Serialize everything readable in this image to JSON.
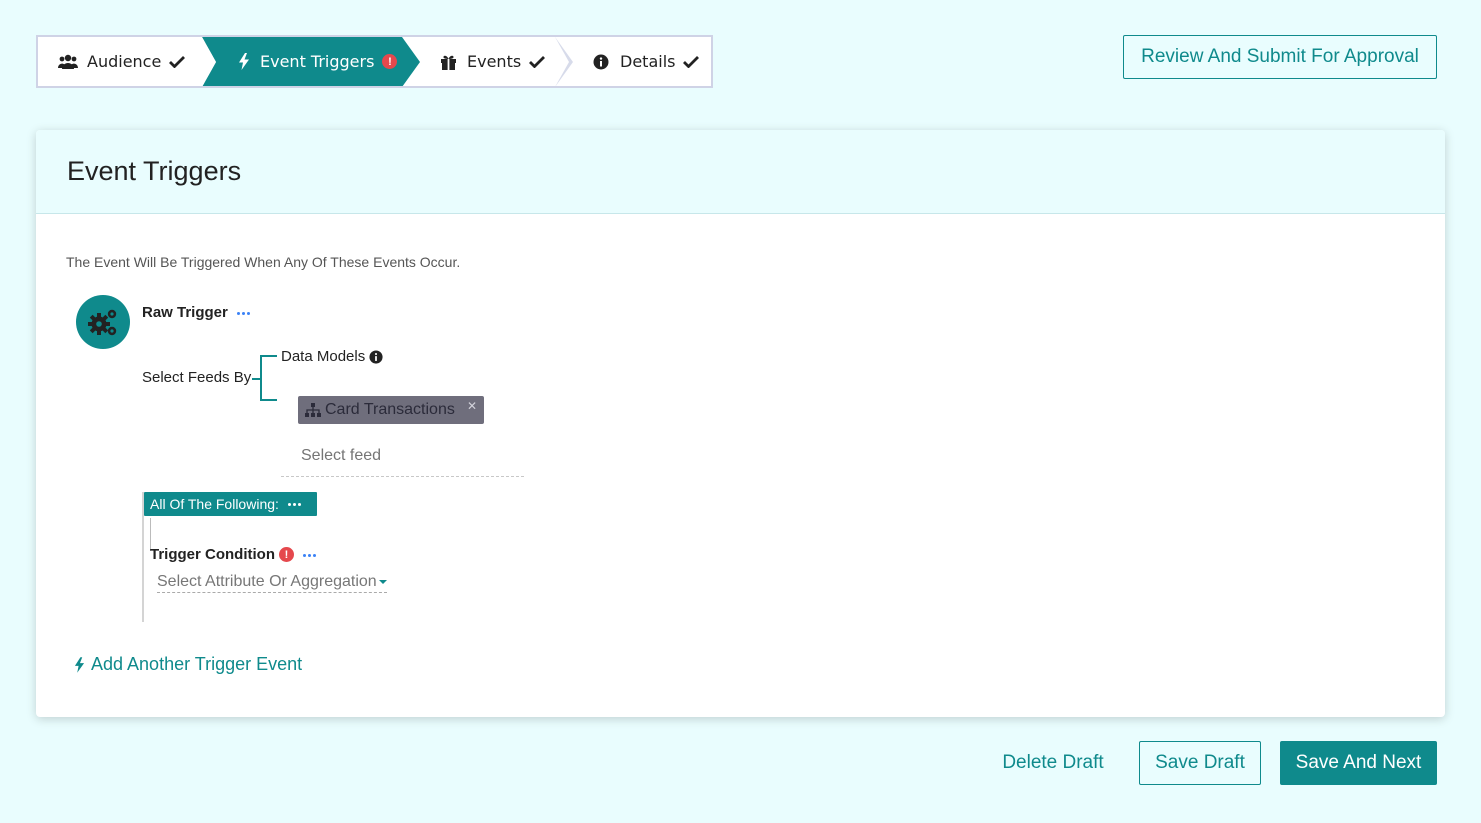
{
  "stepper": {
    "steps": [
      {
        "label": "Audience",
        "icon": "users-icon",
        "status": "complete"
      },
      {
        "label": "Event Triggers",
        "icon": "bolt-icon",
        "status": "error"
      },
      {
        "label": "Events",
        "icon": "gift-icon",
        "status": "complete"
      },
      {
        "label": "Details",
        "icon": "info-icon",
        "status": "complete"
      }
    ],
    "active_index": 1
  },
  "header": {
    "review_button": "Review And Submit For Approval"
  },
  "card": {
    "title": "Event Triggers",
    "intro": "The Event Will Be Triggered When Any Of These Events Occur.",
    "trigger": {
      "title": "Raw Trigger",
      "select_feeds_label": "Select Feeds By",
      "data_models_label": "Data Models",
      "selected_feed": "Card Transactions",
      "feed_placeholder": "Select feed",
      "group_label": "All Of The Following:",
      "condition_label": "Trigger Condition",
      "attribute_placeholder": "Select Attribute Or Aggregation"
    },
    "add_trigger_label": "Add Another Trigger Event"
  },
  "footer": {
    "delete_label": "Delete Draft",
    "save_draft_label": "Save Draft",
    "save_next_label": "Save And Next"
  },
  "colors": {
    "accent": "#0f8a8c",
    "background": "#e9fdfe",
    "error": "#e5484d",
    "chip": "#6f6e7c",
    "link_dots": "#3b82f6"
  }
}
